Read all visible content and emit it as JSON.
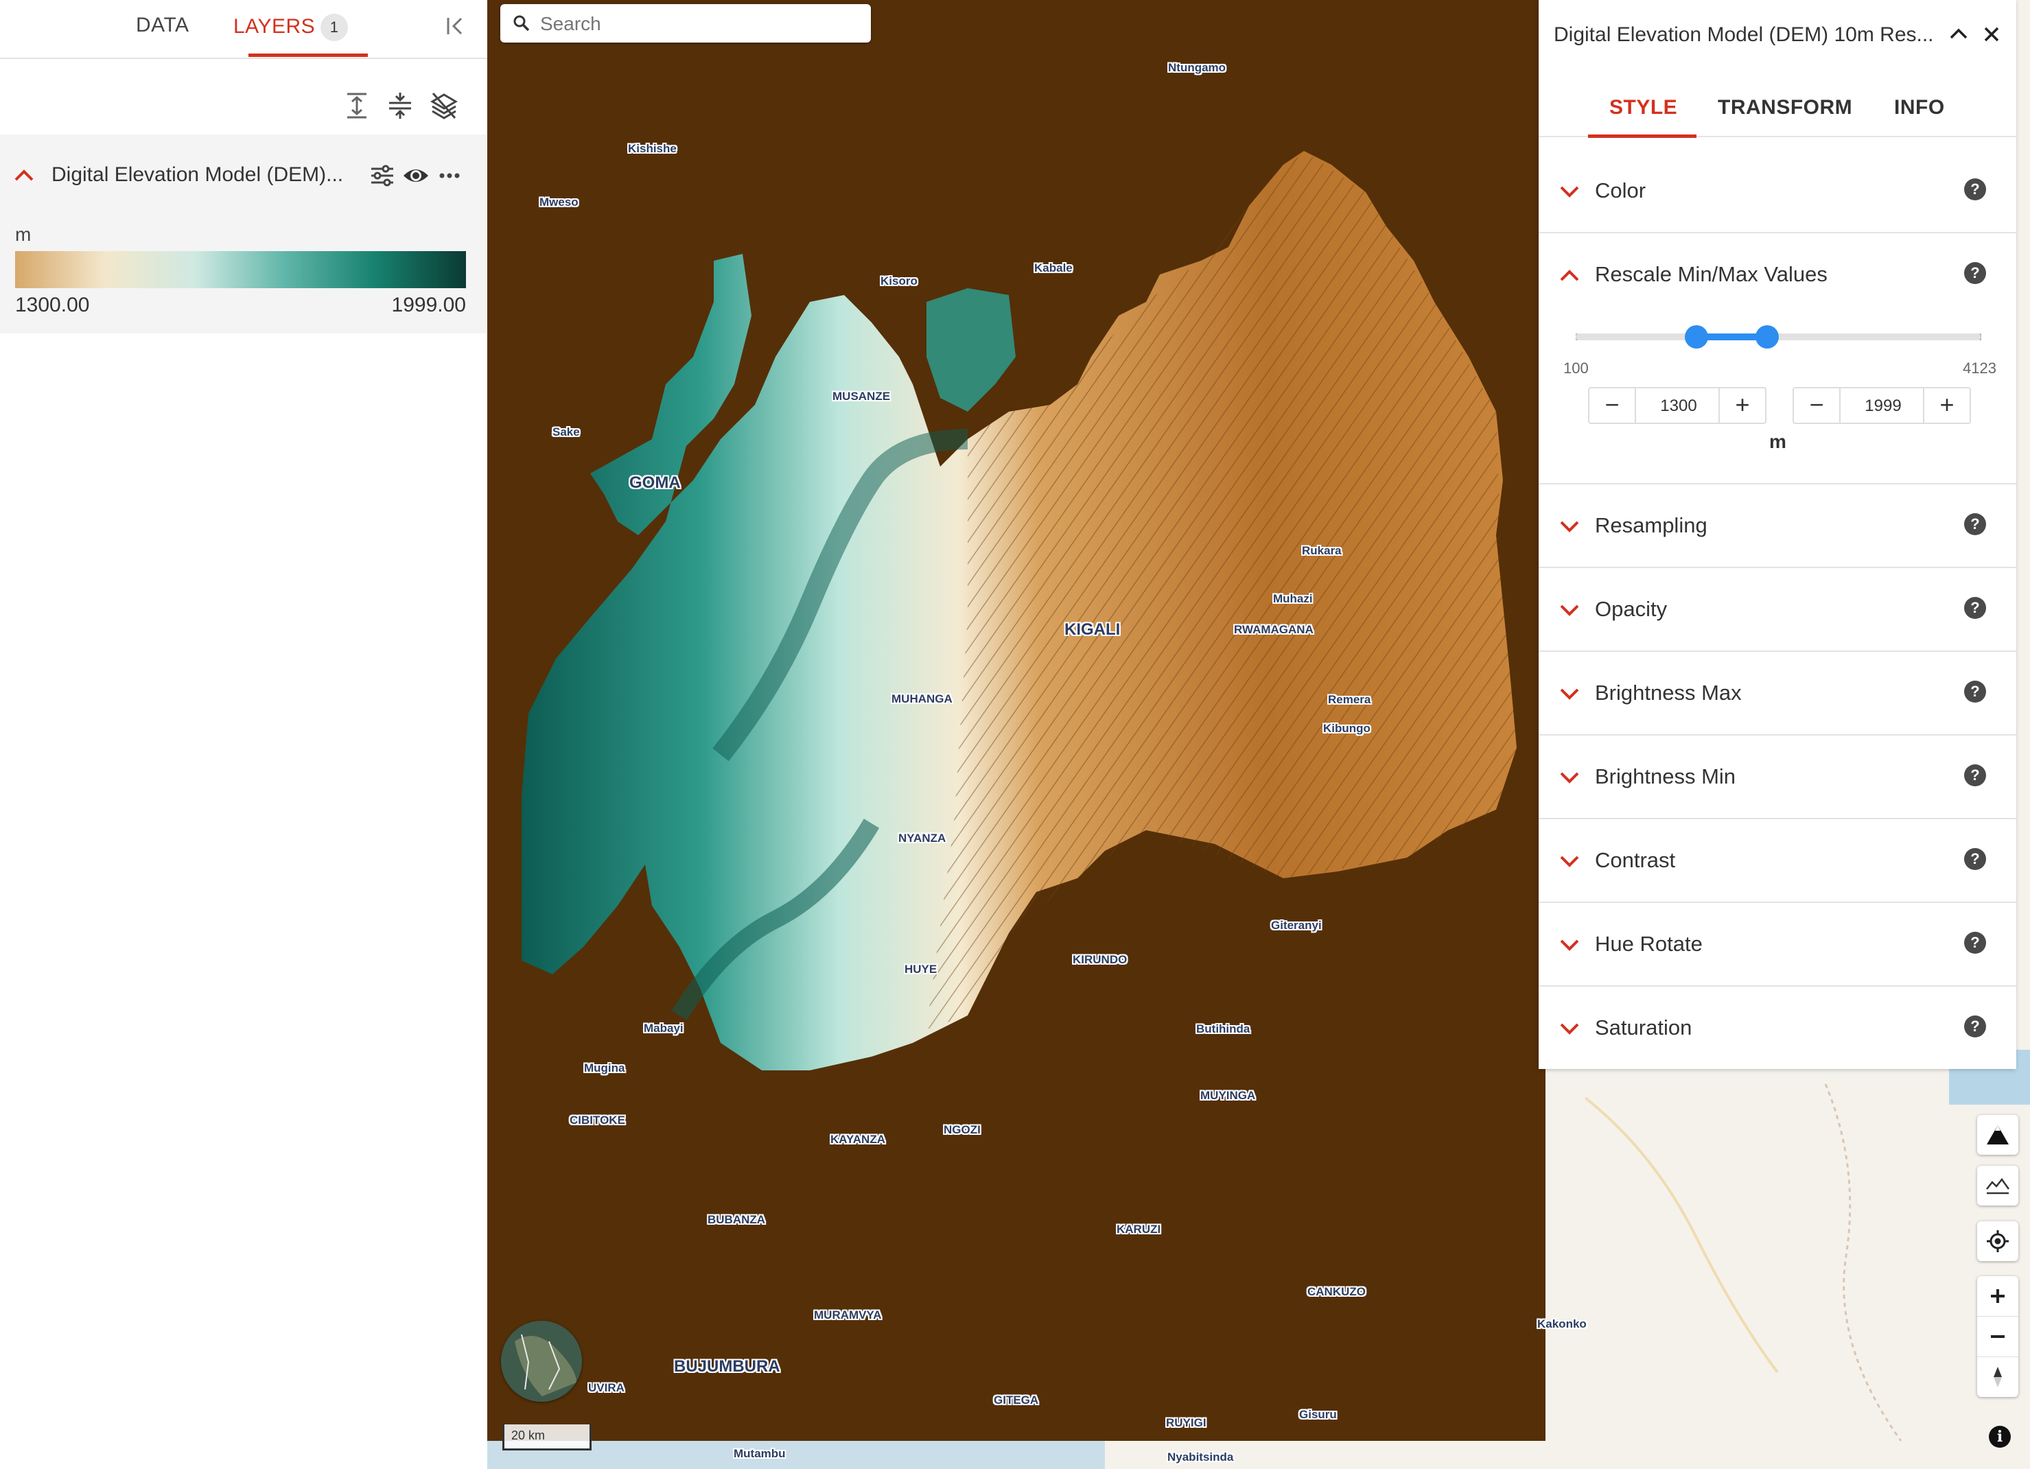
{
  "left_panel": {
    "tabs": {
      "data": "DATA",
      "layers": "LAYERS",
      "layers_count": "1"
    },
    "layer": {
      "title": "Digital Elevation Model (DEM)...",
      "legend_unit": "m",
      "legend_min": "1300.00",
      "legend_max": "1999.00",
      "legend_colors": [
        "#d7a86a",
        "#f3e7cc",
        "#cfe9e2",
        "#5fb5a8",
        "#17816f",
        "#0b3a33"
      ]
    },
    "icons": [
      "expand-all-icon",
      "collapse-all-icon",
      "hide-all-layers-icon",
      "settings-sliders-icon",
      "eye-icon",
      "more-options-icon"
    ]
  },
  "map": {
    "search_placeholder": "Search",
    "scale_label": "20 km",
    "info_label": "i",
    "colors": {
      "background_fill": "#552f08",
      "basemap": "#f5f2ec",
      "high": "#0d5c52",
      "mid": "#f4ead2",
      "low": "#b7722b"
    },
    "places": [
      {
        "name": "Ntungamo",
        "type": "town"
      },
      {
        "name": "Kishishe",
        "type": "town"
      },
      {
        "name": "Mweso",
        "type": "town"
      },
      {
        "name": "Kabale",
        "type": "town"
      },
      {
        "name": "Kisoro",
        "type": "town"
      },
      {
        "name": "MUSANZE",
        "type": "city"
      },
      {
        "name": "Sake",
        "type": "town"
      },
      {
        "name": "GOMA",
        "type": "city"
      },
      {
        "name": "Rukara",
        "type": "town"
      },
      {
        "name": "Muhazi",
        "type": "town"
      },
      {
        "name": "KIGALI",
        "type": "city"
      },
      {
        "name": "RWAMAGANA",
        "type": "city"
      },
      {
        "name": "Remera",
        "type": "town"
      },
      {
        "name": "Kibungo",
        "type": "town"
      },
      {
        "name": "MUHANGA",
        "type": "city"
      },
      {
        "name": "NYANZA",
        "type": "city"
      },
      {
        "name": "Giteranyi",
        "type": "town"
      },
      {
        "name": "KIRUNDO",
        "type": "city"
      },
      {
        "name": "HUYE",
        "type": "city"
      },
      {
        "name": "Mabayi",
        "type": "town"
      },
      {
        "name": "Butihinda",
        "type": "town"
      },
      {
        "name": "Mugina",
        "type": "town"
      },
      {
        "name": "MUYINGA",
        "type": "city"
      },
      {
        "name": "CIBITOKE",
        "type": "city"
      },
      {
        "name": "NGOZI",
        "type": "city"
      },
      {
        "name": "KAYANZA",
        "type": "city"
      },
      {
        "name": "BUBANZA",
        "type": "city"
      },
      {
        "name": "KARUZI",
        "type": "city"
      },
      {
        "name": "CANKUZO",
        "type": "city"
      },
      {
        "name": "Kakonko",
        "type": "town"
      },
      {
        "name": "MURAMVYA",
        "type": "city"
      },
      {
        "name": "BUJUMBURA",
        "type": "city"
      },
      {
        "name": "UVIRA",
        "type": "city"
      },
      {
        "name": "GITEGA",
        "type": "city"
      },
      {
        "name": "Gisuru",
        "type": "town"
      },
      {
        "name": "RUYIGI",
        "type": "city"
      },
      {
        "name": "Mutambu",
        "type": "town"
      },
      {
        "name": "Nyabitsinda",
        "type": "town"
      }
    ],
    "controls": [
      "terrain-3d-icon",
      "terrain-profile-icon",
      "geolocate-icon",
      "zoom-in-icon",
      "zoom-out-icon",
      "compass-icon"
    ]
  },
  "right_panel": {
    "title": "Digital Elevation Model (DEM) 10m Res...",
    "tabs": [
      "STYLE",
      "TRANSFORM",
      "INFO"
    ],
    "active_tab": "STYLE",
    "sections": [
      "Color",
      "Rescale Min/Max Values",
      "Resampling",
      "Opacity",
      "Brightness Max",
      "Brightness Min",
      "Contrast",
      "Hue Rotate",
      "Saturation"
    ],
    "rescale": {
      "range_min": 100,
      "range_max": 4123,
      "range_min_label": "100",
      "range_max_label": "4123",
      "min_value": "1300",
      "max_value": "1999",
      "unit": "m"
    },
    "help_label": "?",
    "accent_color": "#d3311f",
    "slider_color": "#2d8df0"
  }
}
